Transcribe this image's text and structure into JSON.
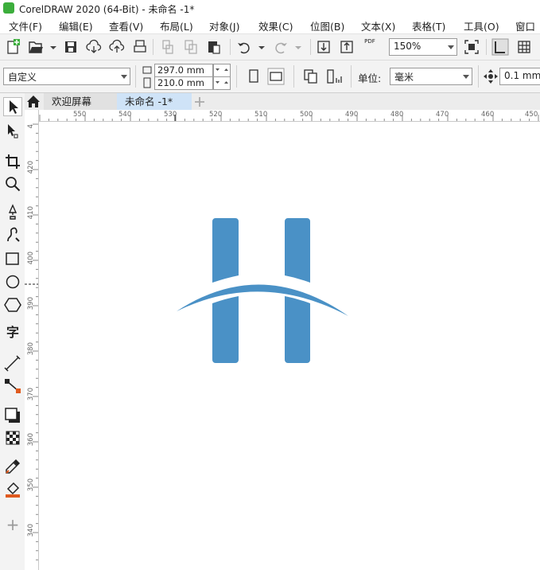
{
  "window": {
    "title": "CorelDRAW 2020 (64-Bit) - 未命名 -1*"
  },
  "menu": [
    {
      "label": "文件(F)"
    },
    {
      "label": "编辑(E)"
    },
    {
      "label": "查看(V)"
    },
    {
      "label": "布局(L)"
    },
    {
      "label": "对象(J)"
    },
    {
      "label": "效果(C)"
    },
    {
      "label": "位图(B)"
    },
    {
      "label": "文本(X)"
    },
    {
      "label": "表格(T)"
    },
    {
      "label": "工具(O)"
    },
    {
      "label": "窗口"
    }
  ],
  "toolbar": {
    "zoom_value": "150%",
    "pdf_label": "PDF"
  },
  "property_bar": {
    "page_preset": "自定义",
    "width_value": "297.0 mm",
    "height_value": "210.0 mm",
    "unit_label": "单位:",
    "unit_value": "毫米",
    "nudge_value": "0.1 mm"
  },
  "tabs": [
    {
      "label": "欢迎屏幕"
    },
    {
      "label": "未命名 -1*"
    }
  ],
  "toolbox": {
    "text_tool_glyph": "字",
    "add_glyph": "+"
  },
  "ruler_h": [
    "550",
    "540",
    "530",
    "520",
    "510",
    "500",
    "490",
    "480",
    "470",
    "460",
    "450"
  ],
  "ruler_v": [
    "4",
    "420",
    "410",
    "400",
    "390",
    "380",
    "370",
    "360",
    "350",
    "340"
  ],
  "logo": {
    "color": "#4a91c6"
  }
}
